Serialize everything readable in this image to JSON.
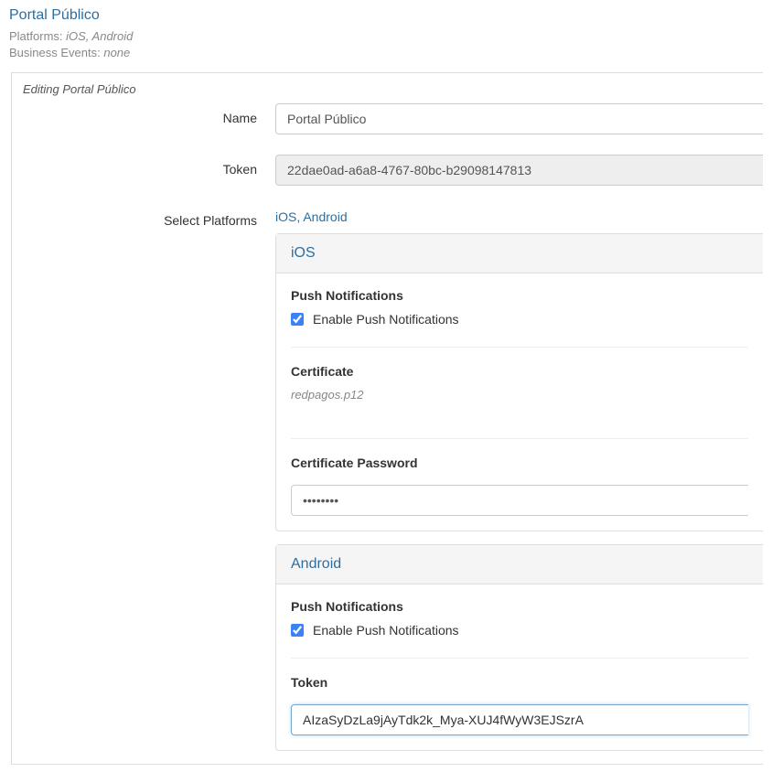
{
  "header": {
    "title": "Portal Público",
    "platforms_label": "Platforms:",
    "platforms_value": "iOS, Android",
    "business_events_label": "Business Events:",
    "business_events_value": "none"
  },
  "panel": {
    "heading": "Editing Portal Público",
    "name_label": "Name",
    "name_value": "Portal Público",
    "token_label": "Token",
    "token_value": "22dae0ad-a6a8-4767-80bc-b29098147813",
    "select_platforms_label": "Select Platforms",
    "platforms_link_text": "iOS, Android"
  },
  "ios": {
    "header": "iOS",
    "push_title": "Push Notifications",
    "enable_label": "Enable Push Notifications",
    "enable_checked": true,
    "cert_title": "Certificate",
    "cert_filename": "redpagos.p12",
    "cert_password_title": "Certificate Password",
    "cert_password_value": "••••••••"
  },
  "android": {
    "header": "Android",
    "push_title": "Push Notifications",
    "enable_label": "Enable Push Notifications",
    "enable_checked": true,
    "token_title": "Token",
    "token_value": "AIzaSyDzLa9jAyTdk2k_Mya-XUJ4fWyW3EJSzrA"
  }
}
